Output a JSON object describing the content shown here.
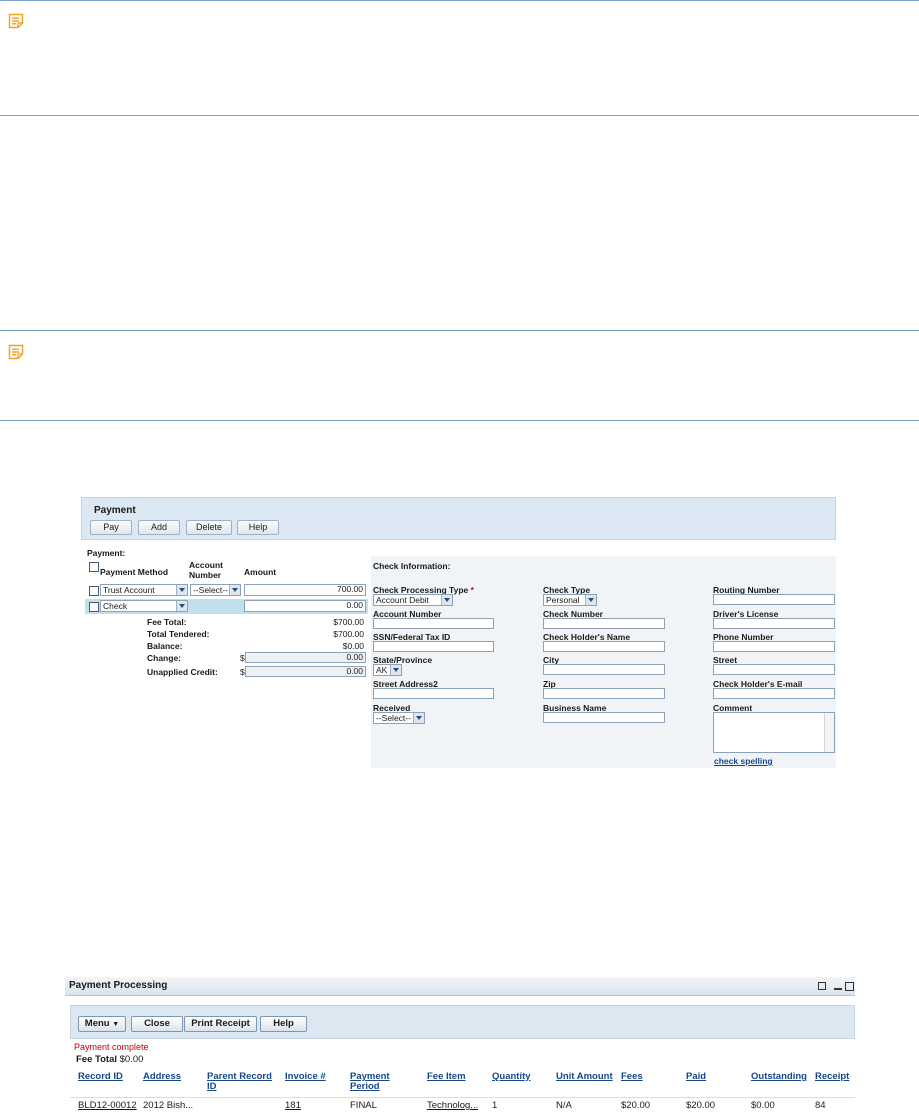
{
  "notes": [
    {
      "icon": "note-icon",
      "icon_color": "#f5a623"
    },
    {
      "icon": "note-icon",
      "icon_color": "#f5a623"
    }
  ],
  "payment_panel": {
    "title": "Payment",
    "buttons": {
      "pay": "Pay",
      "add": "Add",
      "delete": "Delete",
      "help": "Help"
    },
    "section_label": "Payment:",
    "columns": {
      "method": "Payment Method",
      "account": "Account Number",
      "amount": "Amount"
    },
    "rows": [
      {
        "method": "Trust Account",
        "account": "--Select--",
        "amount": "700.00"
      },
      {
        "method": "Check",
        "account": "",
        "amount": "0.00"
      }
    ],
    "summary": {
      "fee_total_label": "Fee Total:",
      "fee_total": "$700.00",
      "tendered_label": "Total Tendered:",
      "tendered": "$700.00",
      "balance_label": "Balance:",
      "balance": "$0.00",
      "change_label": "Change:",
      "change_currency": "$",
      "change": "0.00",
      "credit_label": "Unapplied Credit:",
      "credit_currency": "$",
      "credit": "0.00"
    },
    "check_info": {
      "heading": "Check Information:",
      "processing_type_label": "Check Processing Type",
      "required_mark": "*",
      "processing_type_value": "Account Debit",
      "check_type_label": "Check Type",
      "check_type_value": "Personal",
      "routing_label": "Routing Number",
      "account_number_label": "Account Number",
      "check_number_label": "Check Number",
      "drivers_license_label": "Driver's License",
      "ssn_label": "SSN/Federal Tax ID",
      "holder_name_label": "Check Holder's Name",
      "phone_label": "Phone Number",
      "state_label": "State/Province",
      "state_value": "AK",
      "city_label": "City",
      "street_label": "Street",
      "street2_label": "Street Address2",
      "zip_label": "Zip",
      "email_label": "Check Holder's E-mail",
      "received_label": "Received",
      "received_value": "--Select--",
      "business_label": "Business Name",
      "comment_label": "Comment",
      "spell_link": "check spelling"
    }
  },
  "processing_panel": {
    "title": "Payment Processing",
    "buttons": {
      "menu": "Menu",
      "close": "Close",
      "print": "Print Receipt",
      "help": "Help"
    },
    "status": "Payment complete",
    "status_color": "#cc0000",
    "fee_total_label": "Fee Total",
    "fee_total": "$0.00",
    "columns": [
      "Record ID",
      "Address",
      "Parent Record ID",
      "Invoice #",
      "Payment Period",
      "Fee Item",
      "Quantity",
      "Unit Amount",
      "Fees",
      "Paid",
      "Outstanding",
      "Receipt"
    ],
    "row": {
      "record_id": "BLD12-00012",
      "address": "2012 Bish...",
      "parent_id": "",
      "invoice": "181",
      "period": "FINAL",
      "fee_item": "Technolog...",
      "quantity": "1",
      "unit_amount": "N/A",
      "fees": "$20.00",
      "paid": "$20.00",
      "outstanding": "$0.00",
      "receipt": "84"
    }
  }
}
